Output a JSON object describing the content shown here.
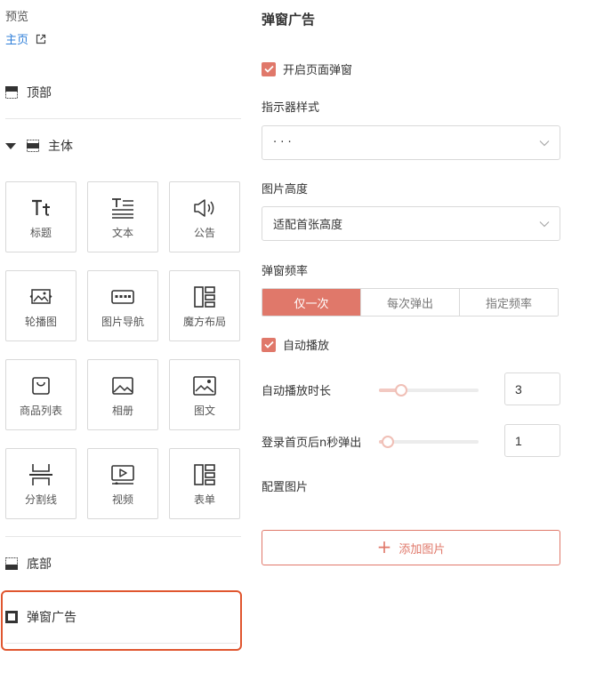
{
  "left": {
    "preview": {
      "title": "预览",
      "home_link": "主页",
      "link_icon": "external-link-icon"
    },
    "sections": {
      "top": "顶部",
      "main": "主体",
      "bottom": "底部",
      "popup": "弹窗广告"
    },
    "components": [
      {
        "label": "标题",
        "icon": "title-text-icon"
      },
      {
        "label": "文本",
        "icon": "text-lines-icon"
      },
      {
        "label": "公告",
        "icon": "speaker-icon"
      },
      {
        "label": "轮播图",
        "icon": "carousel-image-icon"
      },
      {
        "label": "图片导航",
        "icon": "image-nav-icon"
      },
      {
        "label": "魔方布局",
        "icon": "cube-layout-icon"
      },
      {
        "label": "商品列表",
        "icon": "shopping-bag-icon"
      },
      {
        "label": "相册",
        "icon": "album-image-icon"
      },
      {
        "label": "图文",
        "icon": "image-text-icon"
      },
      {
        "label": "分割线",
        "icon": "divider-icon"
      },
      {
        "label": "视频",
        "icon": "video-play-icon"
      },
      {
        "label": "表单",
        "icon": "form-icon"
      }
    ]
  },
  "right": {
    "title": "弹窗广告",
    "enable_popup": {
      "label": "开启页面弹窗",
      "checked": true
    },
    "indicator": {
      "label": "指示器样式",
      "value": "· · ·"
    },
    "image_height": {
      "label": "图片高度",
      "value": "适配首张高度"
    },
    "frequency": {
      "label": "弹窗频率",
      "options": [
        "仅一次",
        "每次弹出",
        "指定频率"
      ],
      "selected": "仅一次"
    },
    "autoplay": {
      "label": "自动播放",
      "checked": true
    },
    "autoplay_duration": {
      "label": "自动播放时长",
      "value": "3",
      "level": 0.22
    },
    "login_delay": {
      "label": "登录首页后n秒弹出",
      "value": "1",
      "level": 0.09
    },
    "config_images": {
      "label": "配置图片"
    },
    "add_image_button": {
      "label": "添加图片"
    }
  },
  "colors": {
    "accent": "#e0786a",
    "link": "#2f7fd9",
    "highlight_border": "#e0562f"
  }
}
